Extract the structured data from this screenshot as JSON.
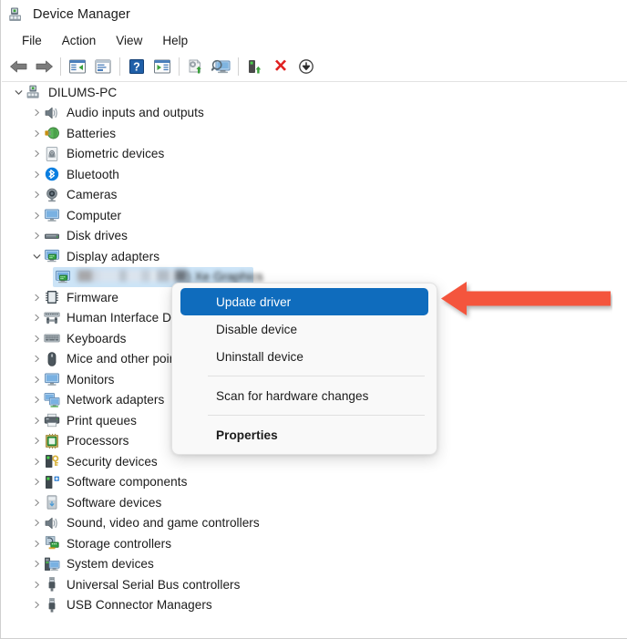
{
  "window": {
    "title": "Device Manager",
    "app_icon": "device-manager-icon"
  },
  "menubar": {
    "items": [
      {
        "label": "File"
      },
      {
        "label": "Action"
      },
      {
        "label": "View"
      },
      {
        "label": "Help"
      }
    ]
  },
  "toolbar": {
    "buttons": [
      {
        "name": "back-icon",
        "tooltip": "Back"
      },
      {
        "name": "forward-icon",
        "tooltip": "Forward"
      },
      {
        "name": "separator-1",
        "tooltip": ""
      },
      {
        "name": "show-hide-console-tree-icon",
        "tooltip": "Show/Hide Console Tree"
      },
      {
        "name": "properties-icon",
        "tooltip": "Properties"
      },
      {
        "name": "separator-2",
        "tooltip": ""
      },
      {
        "name": "help-icon",
        "tooltip": "Help"
      },
      {
        "name": "show-hide-action-pane-icon",
        "tooltip": "Show/Hide Action Pane"
      },
      {
        "name": "separator-3",
        "tooltip": ""
      },
      {
        "name": "update-driver-icon",
        "tooltip": "Update driver"
      },
      {
        "name": "scan-for-hardware-changes-icon",
        "tooltip": "Scan for hardware changes"
      },
      {
        "name": "separator-4",
        "tooltip": ""
      },
      {
        "name": "enable-device-icon",
        "tooltip": "Enable device"
      },
      {
        "name": "uninstall-device-icon",
        "tooltip": "Uninstall device"
      },
      {
        "name": "disable-device-icon",
        "tooltip": "Disable device"
      }
    ]
  },
  "tree": {
    "root": {
      "label": "DILUMS-PC",
      "icon": "computer-root-icon",
      "expanded": true
    },
    "nodes": [
      {
        "label": "Audio inputs and outputs",
        "icon": "speaker-icon",
        "expanded": false,
        "depth": 1
      },
      {
        "label": "Batteries",
        "icon": "battery-icon",
        "expanded": false,
        "depth": 1
      },
      {
        "label": "Biometric devices",
        "icon": "fingerprint-icon",
        "expanded": false,
        "depth": 1
      },
      {
        "label": "Bluetooth",
        "icon": "bluetooth-icon",
        "expanded": false,
        "depth": 1
      },
      {
        "label": "Cameras",
        "icon": "camera-icon",
        "expanded": false,
        "depth": 1
      },
      {
        "label": "Computer",
        "icon": "monitor-icon",
        "expanded": false,
        "depth": 1
      },
      {
        "label": "Disk drives",
        "icon": "disk-drive-icon",
        "expanded": false,
        "depth": 1
      },
      {
        "label": "Display adapters",
        "icon": "display-adapter-icon",
        "expanded": true,
        "depth": 1
      },
      {
        "label": ") Xe Graphics",
        "icon": "display-adapter-icon",
        "expanded": null,
        "depth": 2,
        "selected": true,
        "redacted": true
      },
      {
        "label": "Firmware",
        "icon": "firmware-icon",
        "expanded": false,
        "depth": 1
      },
      {
        "label": "Human Interface Devices",
        "icon": "hid-icon",
        "expanded": false,
        "depth": 1
      },
      {
        "label": "Keyboards",
        "icon": "keyboard-icon",
        "expanded": false,
        "depth": 1
      },
      {
        "label": "Mice and other pointing devices",
        "icon": "mouse-icon",
        "expanded": false,
        "depth": 1
      },
      {
        "label": "Monitors",
        "icon": "monitor-icon",
        "expanded": false,
        "depth": 1
      },
      {
        "label": "Network adapters",
        "icon": "network-adapter-icon",
        "expanded": false,
        "depth": 1
      },
      {
        "label": "Print queues",
        "icon": "printer-icon",
        "expanded": false,
        "depth": 1
      },
      {
        "label": "Processors",
        "icon": "processor-icon",
        "expanded": false,
        "depth": 1
      },
      {
        "label": "Security devices",
        "icon": "security-device-icon",
        "expanded": false,
        "depth": 1
      },
      {
        "label": "Software components",
        "icon": "software-component-icon",
        "expanded": false,
        "depth": 1
      },
      {
        "label": "Software devices",
        "icon": "software-device-icon",
        "expanded": false,
        "depth": 1
      },
      {
        "label": "Sound, video and game controllers",
        "icon": "speaker-icon",
        "expanded": false,
        "depth": 1
      },
      {
        "label": "Storage controllers",
        "icon": "storage-controller-icon",
        "expanded": false,
        "depth": 1
      },
      {
        "label": "System devices",
        "icon": "system-device-icon",
        "expanded": false,
        "depth": 1
      },
      {
        "label": "Universal Serial Bus controllers",
        "icon": "usb-icon",
        "expanded": false,
        "depth": 1
      },
      {
        "label": "USB Connector Managers",
        "icon": "usb-icon",
        "expanded": false,
        "depth": 1
      }
    ]
  },
  "context_menu": {
    "items": [
      {
        "label": "Update driver",
        "accel": "p",
        "highlighted": true,
        "bold": false
      },
      {
        "label": "Disable device",
        "accel": "D",
        "highlighted": false,
        "bold": false
      },
      {
        "label": "Uninstall device",
        "accel": "U",
        "highlighted": false,
        "bold": false
      },
      {
        "separator": true
      },
      {
        "label": "Scan for hardware changes",
        "accel": "a",
        "highlighted": false,
        "bold": false
      },
      {
        "separator": true
      },
      {
        "label": "Properties",
        "accel": "r",
        "highlighted": false,
        "bold": true
      }
    ]
  },
  "annotation": {
    "arrow": {
      "name": "red-pointer-arrow",
      "direction": "left",
      "color": "#f4553c",
      "points_to": "Update driver"
    }
  },
  "colors": {
    "selection_blue": "#cce4f7",
    "menu_highlight": "#0f6cbd",
    "annotation_red": "#f4553c",
    "window_bg": "#ffffff",
    "menu_bg": "#f9f9f9",
    "text": "#1b1b1b"
  }
}
